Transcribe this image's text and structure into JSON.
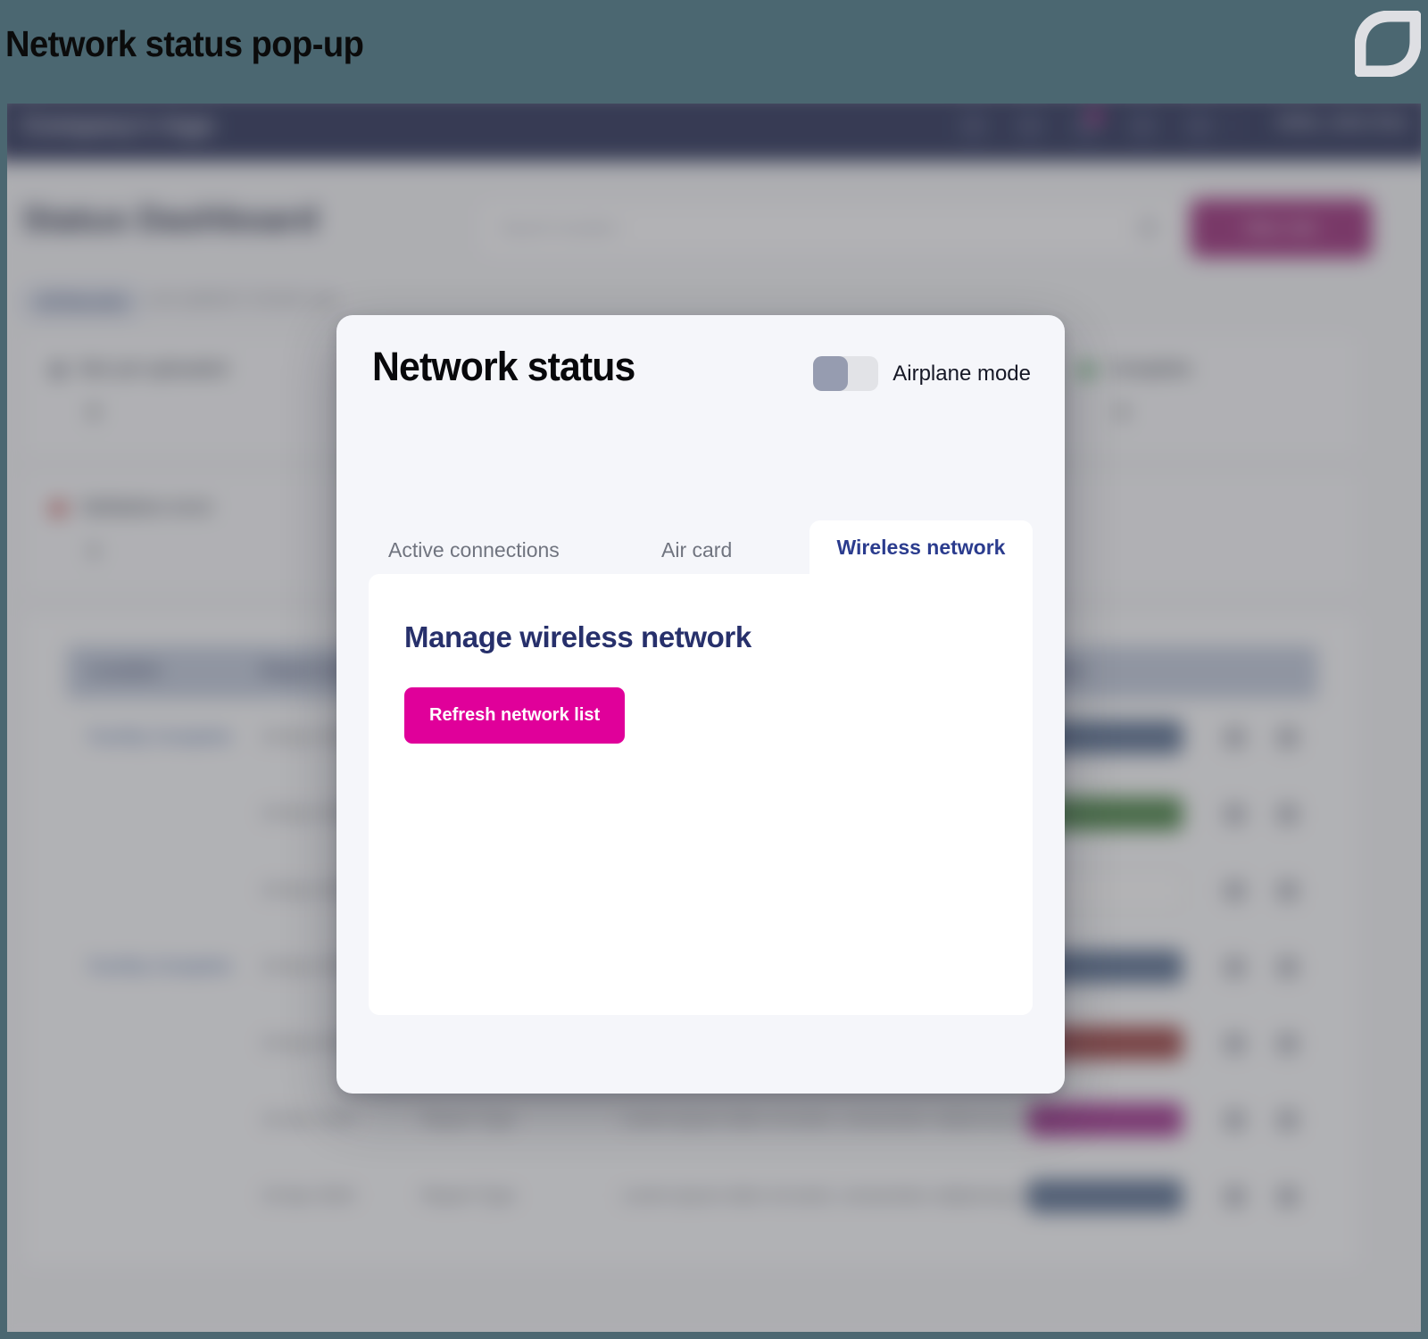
{
  "annotation": {
    "caption": "Network status pop-up",
    "logo_name": "leaf-brand-logo",
    "band_color": "#4b6771"
  },
  "modal": {
    "title": "Network status",
    "airplane": {
      "label": "Airplane mode",
      "state": "off"
    },
    "tabs": [
      {
        "id": "active-connections",
        "label": "Active connections",
        "active": false
      },
      {
        "id": "air-card",
        "label": "Air card",
        "active": false
      },
      {
        "id": "wireless-network",
        "label": "Wireless network",
        "active": true
      }
    ],
    "panel": {
      "heading": "Manage wireless network",
      "refresh_button": "Refresh network list"
    },
    "colors": {
      "accent_magenta": "#e0009a",
      "navy_text": "#27306b",
      "surface": "#f5f6fa"
    }
  },
  "background_app": {
    "topbar": {
      "logo_text": "Company's logo",
      "icons": [
        "chat-icon",
        "bell-icon",
        "alert-icon",
        "help-icon",
        "grid-icon"
      ],
      "notification_badge": true,
      "user": "Hello, John Doe"
    },
    "page_title": "Status Dashboard",
    "search": {
      "placeholder": "Search location",
      "icon": "search-icon"
    },
    "primary_button": "New Job",
    "filter_pill": "All Records",
    "filter_note": "Last updated 2 minutes ago",
    "cards": [
      {
        "status_color": "#6f7486",
        "heading": "Not yet uploaded",
        "value": "0",
        "right_status_color": "#2f9e44",
        "right_heading": "Complete",
        "right_value": "0"
      },
      {
        "status_color": "#c92a2a",
        "heading": "Validation error",
        "value": "1"
      }
    ],
    "table": {
      "columns": [
        "Location",
        "Report Date",
        "Report Type",
        "Description",
        "Status",
        "Edit",
        "..."
      ],
      "rows": [
        {
          "location": "Facility Complete",
          "date": "10 Apr 2024",
          "type": "",
          "description": "",
          "status": "In progress",
          "status_color": "#44618d"
        },
        {
          "location": "",
          "date": "10 Apr 2024",
          "type": "",
          "description": "",
          "status": "Complete",
          "status_color": "#2f7a2a"
        },
        {
          "location": "",
          "date": "10 Apr 2024",
          "type": "",
          "description": "",
          "status": "Draft",
          "status_color": "#ffffff"
        },
        {
          "location": "Facility Complete",
          "date": "10 Apr 2024",
          "type": "",
          "description": "",
          "status": "In progress",
          "status_color": "#44618d"
        },
        {
          "location": "",
          "date": "10 Apr 2024",
          "type": "",
          "description": "",
          "status": "Error",
          "status_color": "#9e2a2a"
        },
        {
          "location": "",
          "date": "10 Apr 2024",
          "type": "Report Type",
          "description": "Lorem ipsum dolor sit amet, consectetur adipiscing elit",
          "status": "Submitted",
          "status_color": "#a3158c"
        },
        {
          "location": "",
          "date": "10 Apr 2024",
          "type": "Report Type",
          "description": "Lorem ipsum dolor sit amet, consectetur adipiscing elit",
          "status": "In progress",
          "status_color": "#44618d"
        }
      ]
    }
  }
}
